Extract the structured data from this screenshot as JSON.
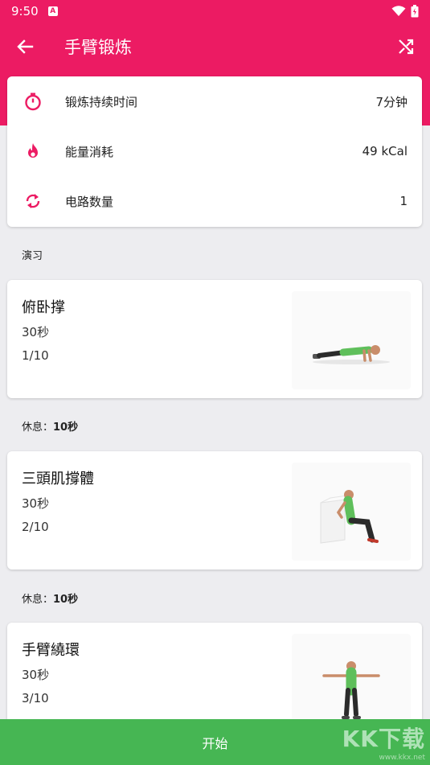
{
  "status_bar": {
    "time": "9:50",
    "badge": "A"
  },
  "app_bar": {
    "title": "手臂锻炼"
  },
  "summary": [
    {
      "icon": "stopwatch-icon",
      "label": "锻炼持续时间",
      "value": "7分钟"
    },
    {
      "icon": "flame-icon",
      "label": "能量消耗",
      "value": "49 kCal"
    },
    {
      "icon": "repeat-icon",
      "label": "电路数量",
      "value": "1"
    }
  ],
  "section_title": "演习",
  "rest": {
    "label": "休息：",
    "value": "10秒"
  },
  "exercises": [
    {
      "name": "俯卧撑",
      "duration": "30秒",
      "index": "1/10"
    },
    {
      "name": "三頭肌撐體",
      "duration": "30秒",
      "index": "2/10"
    },
    {
      "name": "手臂繞環",
      "duration": "30秒",
      "index": "3/10"
    }
  ],
  "start_button": "开始",
  "watermark": {
    "brand": "KK下载",
    "url": "www.kkx.net"
  },
  "colors": {
    "primary": "#ec1b63",
    "accent_green": "#46b653",
    "background": "#ededf0"
  }
}
